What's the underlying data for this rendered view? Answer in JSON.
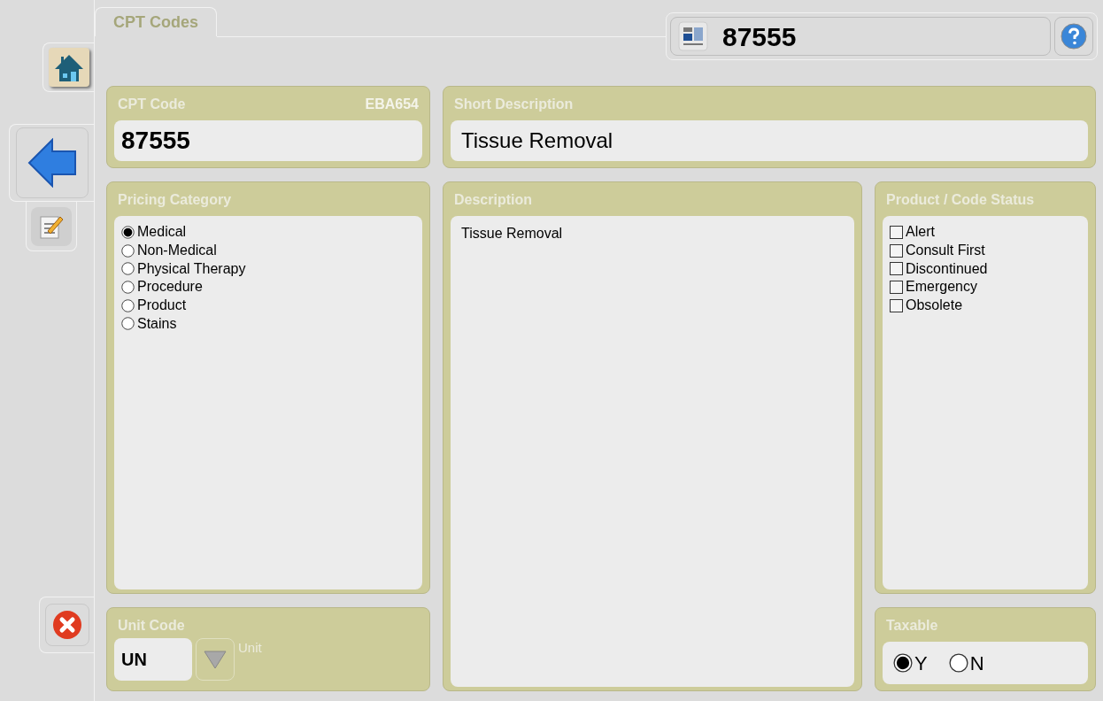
{
  "tab": {
    "label": "CPT Codes",
    "selected": true
  },
  "header": {
    "code": "87555"
  },
  "cpt_code": {
    "label": "CPT Code",
    "id": "EBA654",
    "value": "87555"
  },
  "short_description": {
    "label": "Short Description",
    "value": "Tissue Removal"
  },
  "pricing_category": {
    "label": "Pricing Category",
    "options": [
      {
        "label": "Medical",
        "selected": true
      },
      {
        "label": "Non-Medical",
        "selected": false
      },
      {
        "label": "Physical Therapy",
        "selected": false
      },
      {
        "label": "Procedure",
        "selected": false
      },
      {
        "label": "Product",
        "selected": false
      },
      {
        "label": "Stains",
        "selected": false
      }
    ]
  },
  "description": {
    "label": "Description",
    "value": "Tissue Removal"
  },
  "status": {
    "label": "Product / Code Status",
    "items": [
      {
        "label": "Alert",
        "checked": false
      },
      {
        "label": "Consult First",
        "checked": false
      },
      {
        "label": "Discontinued",
        "checked": false
      },
      {
        "label": "Emergency",
        "checked": false
      },
      {
        "label": "Obsolete",
        "checked": false
      }
    ]
  },
  "unit_code": {
    "label": "Unit Code",
    "value": "UN",
    "unit_label": "Unit"
  },
  "taxable": {
    "label": "Taxable",
    "options": [
      {
        "label": "Y",
        "selected": true
      },
      {
        "label": "N",
        "selected": false
      }
    ]
  }
}
